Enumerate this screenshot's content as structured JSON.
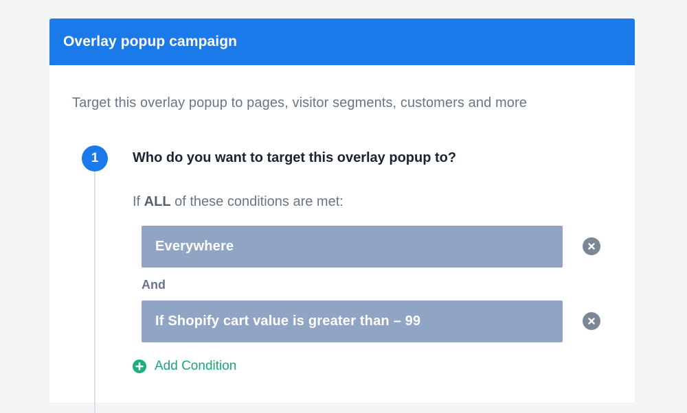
{
  "panel": {
    "title": "Overlay popup campaign",
    "subtitle": "Target this overlay popup to pages, visitor segments, customers and more"
  },
  "step": {
    "number": "1",
    "question": "Who do you want to target this overlay popup to?",
    "intro_prefix": "If ",
    "intro_emphasis": "ALL",
    "intro_suffix": " of these conditions are met:"
  },
  "conditions": [
    {
      "label": "Everywhere",
      "remove_icon": "close-circle-icon"
    },
    {
      "label": "If Shopify cart value is greater than – 99",
      "remove_icon": "close-circle-icon"
    }
  ],
  "joiner": "And",
  "add_condition": {
    "label": "Add Condition",
    "icon": "plus-circle-icon"
  },
  "colors": {
    "header": "#1a7ae9",
    "condition_bg": "#90a5c3",
    "add_green": "#19b07e",
    "remove_gray": "#7b8795"
  }
}
